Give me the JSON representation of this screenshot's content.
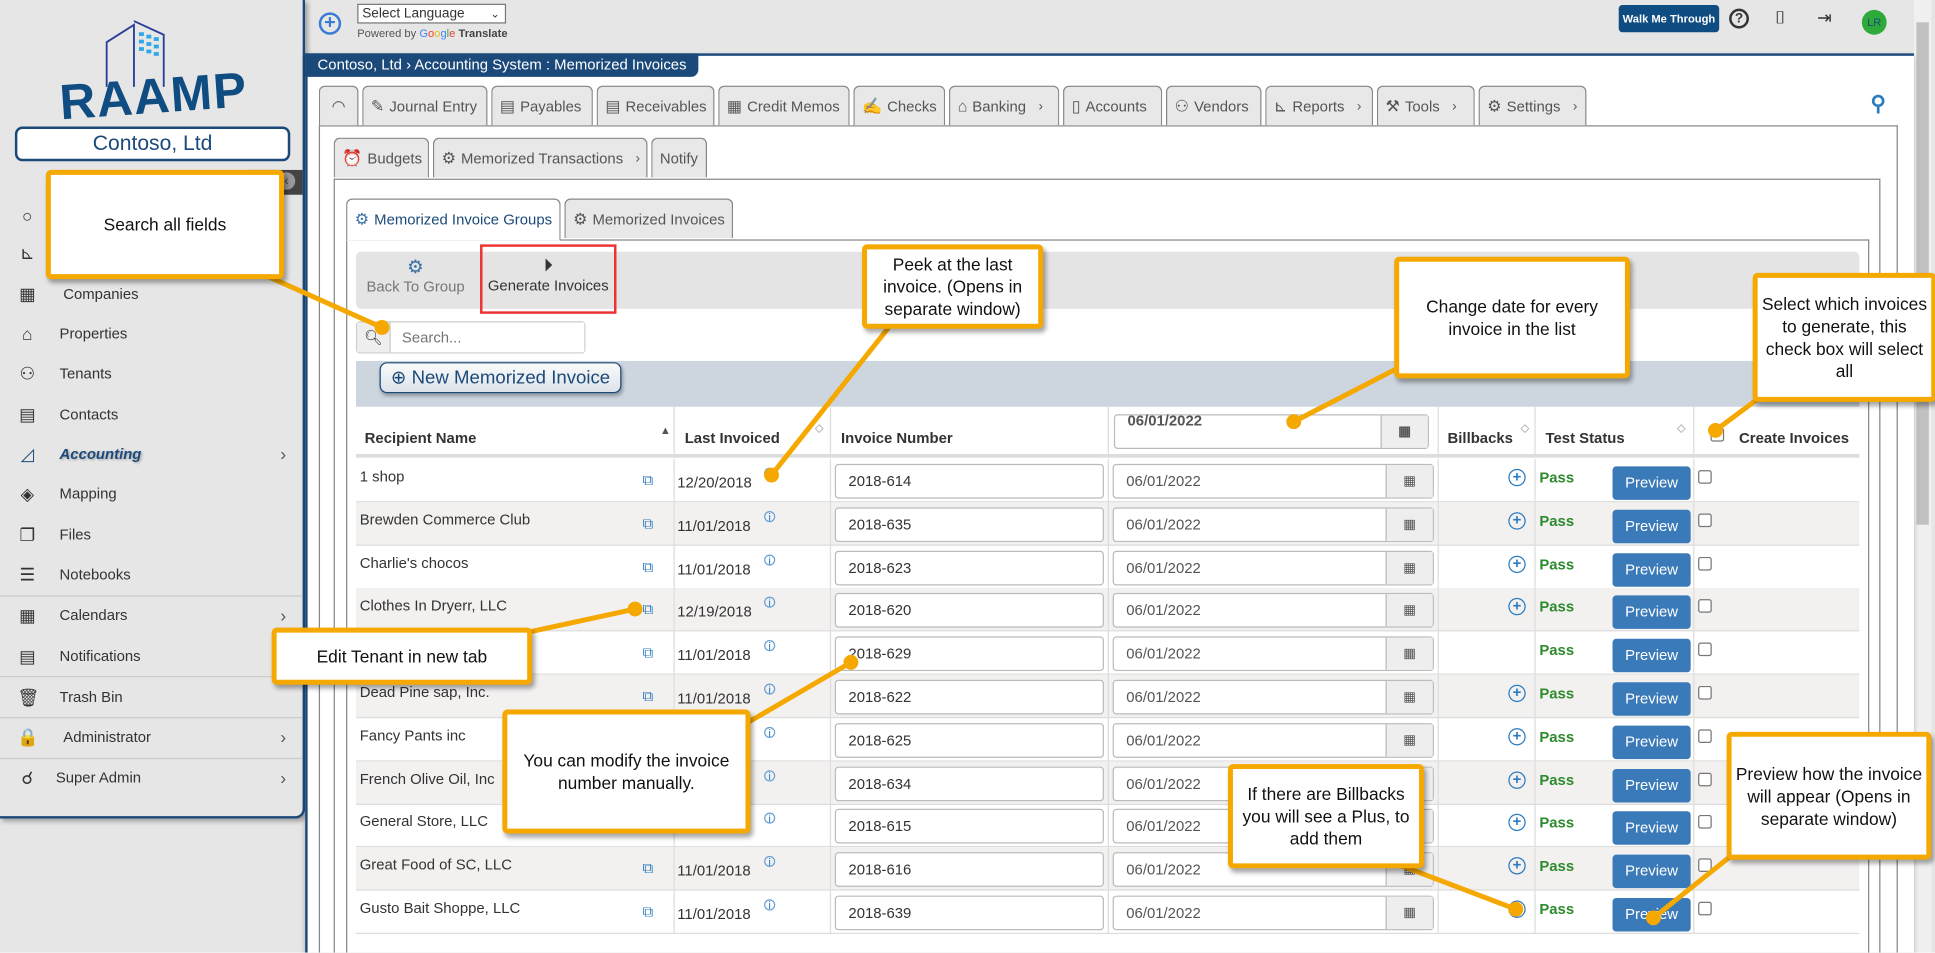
{
  "app": {
    "logo": "RAAMP",
    "company": "Contoso, Ltd"
  },
  "topbar": {
    "language_select": "Select Language",
    "powered_by": "Powered by",
    "google": [
      "G",
      "o",
      "o",
      "g",
      "l",
      "e"
    ],
    "translate": "Translate",
    "walk_me_through": "Walk Me Through",
    "avatar_initials": "LR"
  },
  "breadcrumb": "Contoso, Ltd › Accounting System : Memorized Invoices",
  "sidebar": {
    "items": [
      {
        "label": "",
        "icon": "circle-icon"
      },
      {
        "label": "",
        "icon": "chart-icon"
      },
      {
        "label": "Companies",
        "icon": "building-icon"
      },
      {
        "label": "Properties",
        "icon": "house-icon"
      },
      {
        "label": "Tenants",
        "icon": "user-icon"
      },
      {
        "label": "Contacts",
        "icon": "contact-card-icon"
      },
      {
        "label": "Accounting",
        "icon": "accounting-icon",
        "active": true
      },
      {
        "label": "Mapping",
        "icon": "map-icon"
      },
      {
        "label": "Files",
        "icon": "files-icon"
      },
      {
        "label": "Notebooks",
        "icon": "notebook-icon"
      },
      {
        "label": "Calendars",
        "icon": "calendar-icon"
      },
      {
        "label": "Notifications",
        "icon": "notifications-icon"
      },
      {
        "label": "Trash Bin",
        "icon": "trash-icon"
      },
      {
        "label": "Administrator",
        "icon": "lock-icon"
      },
      {
        "label": "Super Admin",
        "icon": "super-admin-icon"
      }
    ]
  },
  "main_tabs": [
    {
      "label": ""
    },
    {
      "label": "Journal Entry"
    },
    {
      "label": "Payables"
    },
    {
      "label": "Receivables"
    },
    {
      "label": "Credit Memos"
    },
    {
      "label": "Checks"
    },
    {
      "label": "Banking"
    },
    {
      "label": "Accounts"
    },
    {
      "label": "Vendors"
    },
    {
      "label": "Reports"
    },
    {
      "label": "Tools"
    },
    {
      "label": "Settings"
    }
  ],
  "sub_tabs": [
    {
      "label": "Budgets"
    },
    {
      "label": "Memorized Transactions"
    },
    {
      "label": "Notify"
    }
  ],
  "inner_tabs": [
    {
      "label": "Memorized Invoice Groups"
    },
    {
      "label": "Memorized Invoices"
    }
  ],
  "toolbar": {
    "back_to_group": "Back To Group",
    "generate_invoices": "Generate Invoices"
  },
  "search": {
    "placeholder": "Search..."
  },
  "new_button": "New Memorized Invoice",
  "table": {
    "headers": {
      "recipient": "Recipient Name",
      "last_invoiced": "Last Invoiced",
      "invoice_number": "Invoice Number",
      "date_all": "06/01/2022",
      "billbacks": "Billbacks",
      "test_status": "Test Status",
      "create_invoices": "Create Invoices"
    },
    "rows": [
      {
        "name": "1 shop",
        "last": "12/20/2018",
        "inv": "2018-614",
        "date": "06/01/2022",
        "billback": true,
        "status": "Pass",
        "preview": "Preview"
      },
      {
        "name": "Brewden Commerce Club",
        "last": "11/01/2018",
        "inv": "2018-635",
        "date": "06/01/2022",
        "billback": true,
        "status": "Pass",
        "preview": "Preview"
      },
      {
        "name": "Charlie's chocos",
        "last": "11/01/2018",
        "inv": "2018-623",
        "date": "06/01/2022",
        "billback": true,
        "status": "Pass",
        "preview": "Preview"
      },
      {
        "name": "Clothes In Dryerr, LLC",
        "last": "12/19/2018",
        "inv": "2018-620",
        "date": "06/01/2022",
        "billback": true,
        "status": "Pass",
        "preview": "Preview"
      },
      {
        "name": "",
        "last": "11/01/2018",
        "inv": "2018-629",
        "date": "06/01/2022",
        "billback": false,
        "status": "Pass",
        "preview": "Preview"
      },
      {
        "name": "Dead Pine sap, Inc.",
        "last": "11/01/2018",
        "inv": "2018-622",
        "date": "06/01/2022",
        "billback": true,
        "status": "Pass",
        "preview": "Preview"
      },
      {
        "name": "Fancy Pants inc",
        "last": "",
        "inv": "2018-625",
        "date": "06/01/2022",
        "billback": true,
        "status": "Pass",
        "preview": "Preview"
      },
      {
        "name": "French Olive Oil, Inc",
        "last": "",
        "inv": "2018-634",
        "date": "06/01/2022",
        "billback": true,
        "status": "Pass",
        "preview": "Preview"
      },
      {
        "name": "General Store, LLC",
        "last": "",
        "inv": "2018-615",
        "date": "06/01/2022",
        "billback": true,
        "status": "Pass",
        "preview": "Preview"
      },
      {
        "name": "Great Food of SC, LLC",
        "last": "11/01/2018",
        "inv": "2018-616",
        "date": "06/01/2022",
        "billback": true,
        "status": "Pass",
        "preview": "Preview"
      },
      {
        "name": "Gusto Bait Shoppe, LLC",
        "last": "11/01/2018",
        "inv": "2018-639",
        "date": "06/01/2022",
        "billback": true,
        "status": "Pass",
        "preview": "Preview"
      }
    ]
  },
  "callouts": {
    "search": "Search all fields",
    "peek": "Peek at the last invoice. (Opens in separate window)",
    "change_date": "Change date for every invoice in the list",
    "select": "Select which invoices to generate, this check box will select all",
    "edit_tenant": "Edit Tenant in new tab",
    "modify": "You can modify the invoice number manually.",
    "billbacks": "If there are Billbacks you will see a Plus, to add them",
    "preview": "Preview how the invoice will appear (Opens in separate window)"
  },
  "colors": {
    "brand": "#1b4a7a",
    "callout": "#f5a800",
    "pass": "#2e8a2e",
    "preview_button": "#3b7ab8"
  }
}
